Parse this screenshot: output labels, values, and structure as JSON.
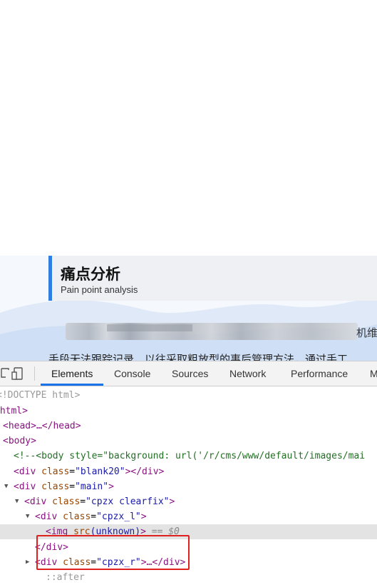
{
  "page": {
    "section_title": "痛点分析",
    "section_subtitle": "Pain point analysis",
    "blurred_tail": "机维",
    "body_text": "手段无法跟踪记录，以往采取粗放型的事后管理方法，通过手工"
  },
  "colors": {
    "accent": "#2f7fe0",
    "tab_underline": "#1a73e8",
    "highlight_box": "#e0201e"
  },
  "devtools": {
    "icons": [
      "inspect-icon",
      "device-toggle-icon"
    ],
    "tabs": [
      "Elements",
      "Console",
      "Sources",
      "Network",
      "Performance",
      "M"
    ],
    "active_tab": "Elements",
    "dom": {
      "doctype": "<!DOCTYPE html>",
      "html_open": "<html>",
      "head": "<head>…</head>",
      "body_open": "<body>",
      "comment": "<!--<body style=\"background: url('/r/cms/www/default/images/mai",
      "blank": {
        "tag": "div",
        "attr": "class",
        "value": "\"blank20\"",
        "close": "></div>"
      },
      "main": {
        "tag": "div",
        "attr": "class",
        "value": "\"main\"",
        "close": ">"
      },
      "cpzx": {
        "tag": "div",
        "attr": "class",
        "value": "\"cpzx clearfix\"",
        "close": ">"
      },
      "cpzx_l": {
        "tag": "div",
        "attr": "class",
        "value": "\"cpzx_l\"",
        "close": ">"
      },
      "img": {
        "tag": "img",
        "attr": "src",
        "value": "(unknown)",
        "close": ">",
        "suffix": "== $0"
      },
      "div_close": "</div>",
      "cpzx_r": {
        "tag": "div",
        "attr": "class",
        "value": "\"cpzx_r\"",
        "close": ">…</div>"
      },
      "last": "::after"
    }
  }
}
